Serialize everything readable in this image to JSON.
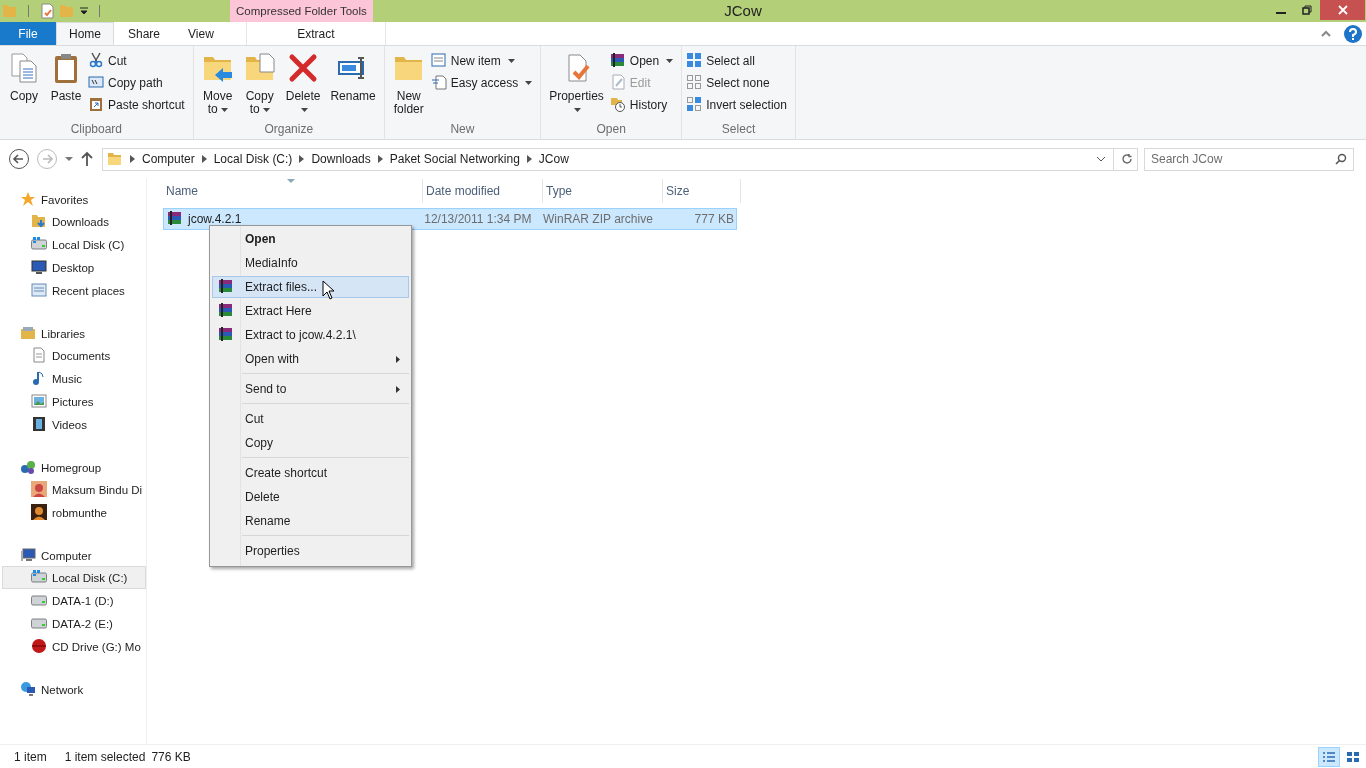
{
  "title_bar": {
    "contextual_group": "Compressed Folder Tools",
    "title": "JCow"
  },
  "tabs": [
    {
      "label": "File",
      "kind": "file",
      "selected": false
    },
    {
      "label": "Home",
      "kind": "normal",
      "selected": true
    },
    {
      "label": "Share",
      "kind": "normal",
      "selected": false
    },
    {
      "label": "View",
      "kind": "normal",
      "selected": false
    },
    {
      "label": "Extract",
      "kind": "contextual",
      "selected": false
    }
  ],
  "ribbon": [
    {
      "label": "Clipboard",
      "columns": [
        {
          "kind": "large",
          "label": "Copy",
          "dropdown": false
        },
        {
          "kind": "large",
          "label": "Paste",
          "dropdown": false
        },
        {
          "kind": "stack",
          "items": [
            {
              "label": "Cut",
              "dropdown": false,
              "disabled": false
            },
            {
              "label": "Copy path",
              "dropdown": false,
              "disabled": false
            },
            {
              "label": "Paste shortcut",
              "dropdown": false,
              "disabled": false
            }
          ]
        }
      ]
    },
    {
      "label": "Organize",
      "columns": [
        {
          "kind": "large",
          "label": "Move to",
          "dropdown": true
        },
        {
          "kind": "large",
          "label": "Copy to",
          "dropdown": true
        },
        {
          "kind": "large",
          "label": "Delete",
          "dropdown": true
        },
        {
          "kind": "large",
          "label": "Rename",
          "dropdown": false
        }
      ]
    },
    {
      "label": "New",
      "columns": [
        {
          "kind": "large",
          "label": "New folder",
          "dropdown": false
        },
        {
          "kind": "stack",
          "items": [
            {
              "label": "New item",
              "dropdown": true,
              "disabled": false
            },
            {
              "label": "Easy access",
              "dropdown": true,
              "disabled": false
            }
          ]
        }
      ]
    },
    {
      "label": "Open",
      "columns": [
        {
          "kind": "large",
          "label": "Properties",
          "dropdown": true
        },
        {
          "kind": "stack",
          "items": [
            {
              "label": "Open",
              "dropdown": true,
              "disabled": false
            },
            {
              "label": "Edit",
              "dropdown": false,
              "disabled": true
            },
            {
              "label": "History",
              "dropdown": false,
              "disabled": false
            }
          ]
        }
      ]
    },
    {
      "label": "Select",
      "columns": [
        {
          "kind": "stack",
          "items": [
            {
              "label": "Select all",
              "dropdown": false,
              "disabled": false
            },
            {
              "label": "Select none",
              "dropdown": false,
              "disabled": false
            },
            {
              "label": "Invert selection",
              "dropdown": false,
              "disabled": false
            }
          ]
        }
      ]
    }
  ],
  "address": {
    "path": [
      "Computer",
      "Local Disk (C:)",
      "Downloads",
      "Paket Social Networking",
      "JCow"
    ],
    "search": {
      "placeholder": "Search JCow"
    }
  },
  "sidebar": [
    {
      "label": "Favorites",
      "children": [
        {
          "label": "Downloads",
          "selected": false
        },
        {
          "label": "Local Disk (C)",
          "selected": false
        },
        {
          "label": "Desktop",
          "selected": false
        },
        {
          "label": "Recent places",
          "selected": false
        }
      ]
    },
    {
      "label": "Libraries",
      "children": [
        {
          "label": "Documents",
          "selected": false
        },
        {
          "label": "Music",
          "selected": false
        },
        {
          "label": "Pictures",
          "selected": false
        },
        {
          "label": "Videos",
          "selected": false
        }
      ]
    },
    {
      "label": "Homegroup",
      "children": [
        {
          "label": "Maksum Bindu Di",
          "selected": false
        },
        {
          "label": "robmunthe",
          "selected": false
        }
      ]
    },
    {
      "label": "Computer",
      "children": [
        {
          "label": "Local Disk (C:)",
          "selected": true
        },
        {
          "label": "DATA-1 (D:)",
          "selected": false
        },
        {
          "label": "DATA-2 (E:)",
          "selected": false
        },
        {
          "label": "CD Drive (G:) Mo",
          "selected": false
        }
      ]
    },
    {
      "label": "Network"
    }
  ],
  "table": {
    "columns": [
      "Name",
      "Date modified",
      "Type",
      "Size"
    ],
    "rows": [
      {
        "name": "jcow.4.2.1",
        "date": "12/13/2011 1:34 PM",
        "type": "WinRAR ZIP archive",
        "size": "777 KB",
        "selected": true
      }
    ]
  },
  "context_menu": [
    {
      "kind": "item",
      "label": "Open",
      "bold": true,
      "icon": false,
      "submenu": false,
      "selected": false
    },
    {
      "kind": "item",
      "label": "MediaInfo",
      "bold": false,
      "icon": false,
      "submenu": false,
      "selected": false
    },
    {
      "kind": "item",
      "label": "Extract files...",
      "bold": false,
      "icon": true,
      "submenu": false,
      "selected": true
    },
    {
      "kind": "item",
      "label": "Extract Here",
      "bold": false,
      "icon": true,
      "submenu": false,
      "selected": false
    },
    {
      "kind": "item",
      "label": "Extract to jcow.4.2.1\\",
      "bold": false,
      "icon": true,
      "submenu": false,
      "selected": false
    },
    {
      "kind": "item",
      "label": "Open with",
      "bold": false,
      "icon": false,
      "submenu": true,
      "selected": false
    },
    {
      "kind": "separator"
    },
    {
      "kind": "item",
      "label": "Send to",
      "bold": false,
      "icon": false,
      "submenu": true,
      "selected": false
    },
    {
      "kind": "separator"
    },
    {
      "kind": "item",
      "label": "Cut",
      "bold": false,
      "icon": false,
      "submenu": false,
      "selected": false
    },
    {
      "kind": "item",
      "label": "Copy",
      "bold": false,
      "icon": false,
      "submenu": false,
      "selected": false
    },
    {
      "kind": "separator"
    },
    {
      "kind": "item",
      "label": "Create shortcut",
      "bold": false,
      "icon": false,
      "submenu": false,
      "selected": false
    },
    {
      "kind": "item",
      "label": "Delete",
      "bold": false,
      "icon": false,
      "submenu": false,
      "selected": false
    },
    {
      "kind": "item",
      "label": "Rename",
      "bold": false,
      "icon": false,
      "submenu": false,
      "selected": false
    },
    {
      "kind": "separator"
    },
    {
      "kind": "item",
      "label": "Properties",
      "bold": false,
      "icon": false,
      "submenu": false,
      "selected": false
    }
  ],
  "status_bar": {
    "item_count": "1 item",
    "selection": "1 item selected",
    "selection_size": "776 KB",
    "views": [
      {
        "kind": "details",
        "selected": true
      },
      {
        "kind": "large_icons",
        "selected": false
      }
    ]
  }
}
